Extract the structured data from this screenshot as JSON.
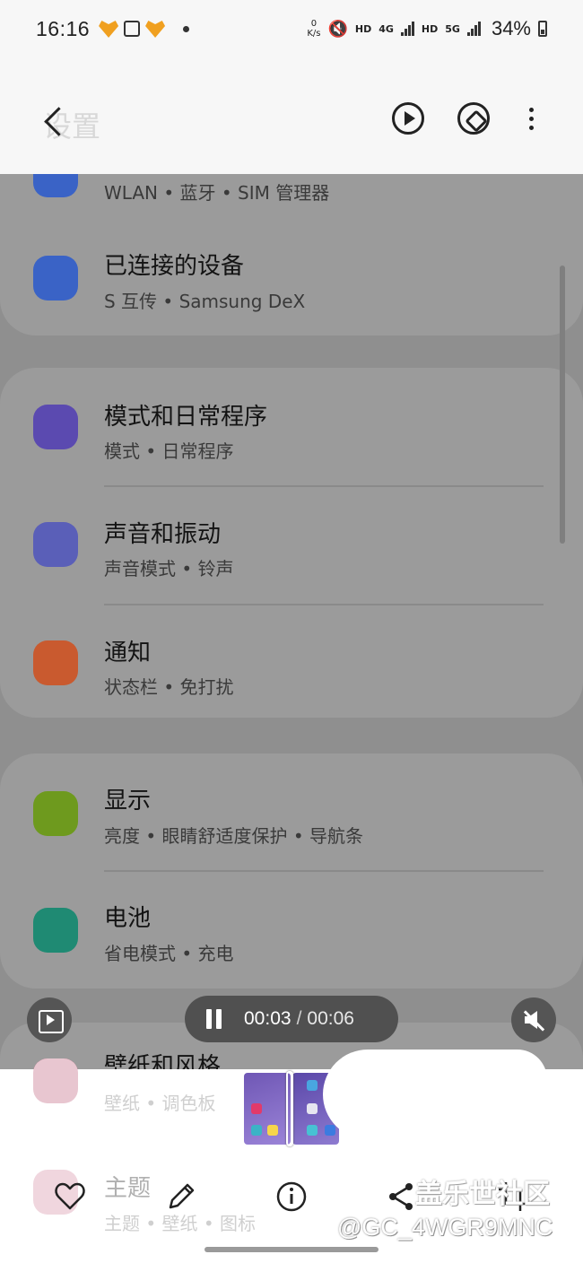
{
  "status_bar": {
    "time": "16:16",
    "net_speed_value": "0",
    "net_speed_unit": "K/s",
    "hd1": "HD",
    "net1": "4G",
    "hd2": "HD",
    "net2": "5G",
    "battery": "34%"
  },
  "header": {
    "title": "设置"
  },
  "settings": {
    "partial_top_sub": "WLAN • 蓝牙 • SIM 管理器",
    "rows": [
      {
        "title": "已连接的设备",
        "sub": "S 互传 • Samsung DeX",
        "icon": "devices-icon",
        "color": "#3a63c6"
      },
      {
        "title": "模式和日常程序",
        "sub": "模式 • 日常程序",
        "icon": "modes-check-icon",
        "color": "#5b4ab0"
      },
      {
        "title": "声音和振动",
        "sub": "声音模式 • 铃声",
        "icon": "sound-icon",
        "color": "#5a5fb8"
      },
      {
        "title": "通知",
        "sub": "状态栏 • 免打扰",
        "icon": "notification-icon",
        "color": "#c95a2f"
      },
      {
        "title": "显示",
        "sub": "亮度 • 眼睛舒适度保护 • 导航条",
        "icon": "brightness-icon",
        "color": "#6e9a1e"
      },
      {
        "title": "电池",
        "sub": "省电模式 • 充电",
        "icon": "battery-icon",
        "color": "#1f8a73"
      },
      {
        "title": "壁纸和风格",
        "sub": "壁纸 • 调色板",
        "icon": "wallpaper-icon",
        "color": "#c2476a"
      },
      {
        "title": "主题",
        "sub": "主题 • 壁纸 • 图标",
        "icon": "themes-icon",
        "color": "#c2476a"
      }
    ]
  },
  "player": {
    "current": "00:03",
    "separator": "/",
    "total": "00:06",
    "progress_fraction": 0.5
  },
  "watermark": {
    "brand": "盖乐世社区",
    "user": "@GC_4WGR9MNC"
  }
}
